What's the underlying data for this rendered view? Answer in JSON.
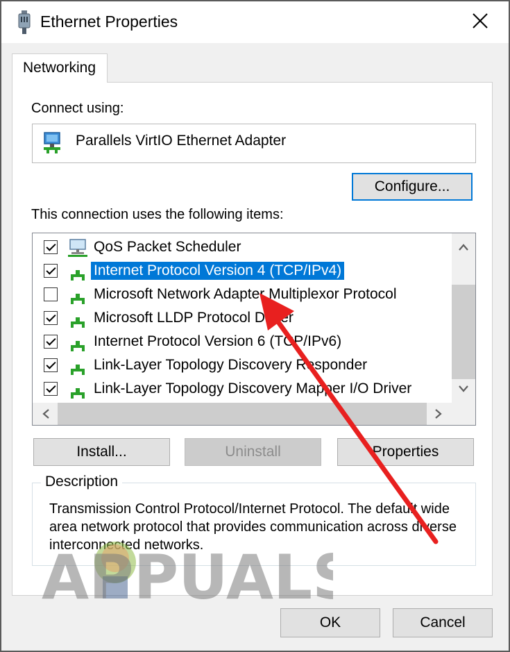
{
  "window": {
    "title": "Ethernet Properties"
  },
  "tabs": [
    {
      "label": "Networking"
    }
  ],
  "connect": {
    "label": "Connect using:",
    "adapter": "Parallels VirtIO Ethernet Adapter"
  },
  "buttons": {
    "configure": "Configure...",
    "install": "Install...",
    "uninstall": "Uninstall",
    "properties": "Properties",
    "ok": "OK",
    "cancel": "Cancel"
  },
  "items_label": "This connection uses the following items:",
  "items": [
    {
      "label": "QoS Packet Scheduler",
      "checked": true,
      "icon": "monitor-network-icon",
      "selected": false
    },
    {
      "label": "Internet Protocol Version 4 (TCP/IPv4)",
      "checked": true,
      "icon": "network-protocol-icon",
      "selected": true
    },
    {
      "label": "Microsoft Network Adapter Multiplexor Protocol",
      "checked": false,
      "icon": "network-protocol-icon",
      "selected": false
    },
    {
      "label": "Microsoft LLDP Protocol Driver",
      "checked": true,
      "icon": "network-protocol-icon",
      "selected": false
    },
    {
      "label": "Internet Protocol Version 6 (TCP/IPv6)",
      "checked": true,
      "icon": "network-protocol-icon",
      "selected": false
    },
    {
      "label": "Link-Layer Topology Discovery Responder",
      "checked": true,
      "icon": "network-protocol-icon",
      "selected": false
    },
    {
      "label": "Link-Layer Topology Discovery Mapper I/O Driver",
      "checked": true,
      "icon": "network-protocol-icon",
      "selected": false
    }
  ],
  "description": {
    "legend": "Description",
    "text": "Transmission Control Protocol/Internet Protocol. The default wide area network protocol that provides communication across diverse interconnected networks."
  },
  "watermark": {
    "text": "APPUALS"
  },
  "colors": {
    "accent": "#0078d7",
    "arrow": "#e8201f",
    "selection": "#0078d7"
  }
}
